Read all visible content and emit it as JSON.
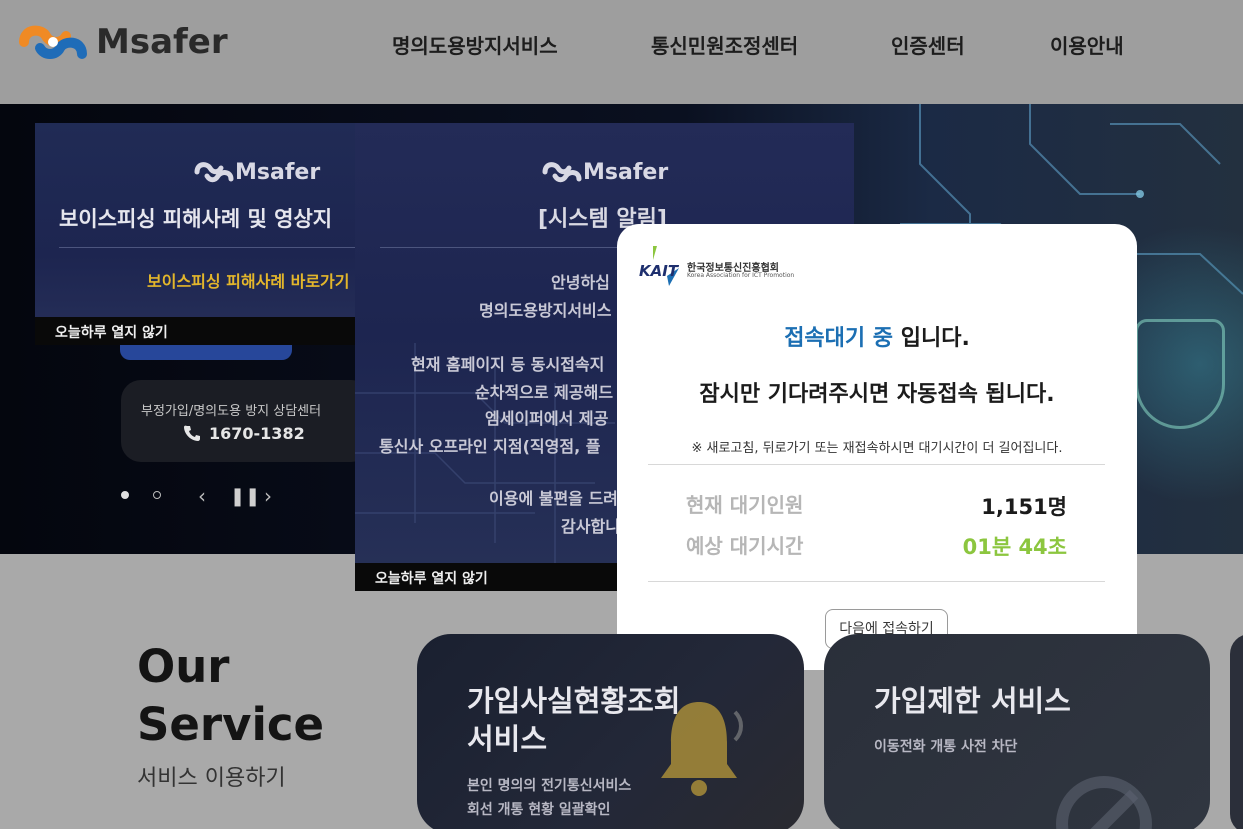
{
  "header": {
    "logo_text": "Msafer",
    "nav": [
      {
        "label": "명의도용방지서비스"
      },
      {
        "label": "통신민원조정센터"
      },
      {
        "label": "인증센터"
      },
      {
        "label": "이용안내"
      }
    ]
  },
  "popup_voice": {
    "logo_text": "Msafer",
    "title": "보이스피싱 피해사례 및 영상지",
    "link": "보이스피싱 피해사례 바로가기",
    "close_today": "오늘하루 열지 않기"
  },
  "counsel": {
    "label": "부정가입/명의도용 방지 상담센터",
    "phone": "1670-1382"
  },
  "popup_system": {
    "logo_text": "Msafer",
    "title": "[시스템 알림]",
    "lines": [
      "안녕하십",
      "명의도용방지서비스",
      "현재 홈페이지 등 동시접속지",
      "순차적으로 제공해드",
      "엠세이퍼에서 제공",
      "통신사 오프라인 지점(직영점, 플",
      "이용에 불편을 드려",
      "감사합니"
    ],
    "close_today": "오늘하루 열지 않기"
  },
  "modal": {
    "org_abbr": "KAIT",
    "org_name": "한국정보통신진흥협회",
    "org_name_en": "Korea Association for ICT Promotion",
    "status_accent": "접속대기 중",
    "status_rest": " 입니다.",
    "message": "잠시만 기다려주시면 자동접속 됩니다.",
    "note": "※ 새로고침, 뒤로가기 또는 재접속하시면 대기시간이 더 길어집니다.",
    "waiting_label": "현재 대기인원",
    "waiting_value": "1,151명",
    "time_label": "예상 대기시간",
    "time_value": "01분 44초",
    "later_button": "다음에 접속하기",
    "colors": {
      "accent": "#1c6fb3",
      "time": "#8cc63f"
    }
  },
  "service": {
    "title_line1": "Our",
    "title_line2": "Service",
    "subtitle": "서비스 이용하기",
    "cards": [
      {
        "title_line1": "가입사실현황조회",
        "title_line2": "서비스",
        "desc_line1": "본인 명의의 전기통신서비스",
        "desc_line2": "회선 개통 현황 일괄확인"
      },
      {
        "title_line1": "가입제한 서비스",
        "desc_line1": "이동전화 개통 사전 차단"
      }
    ]
  }
}
